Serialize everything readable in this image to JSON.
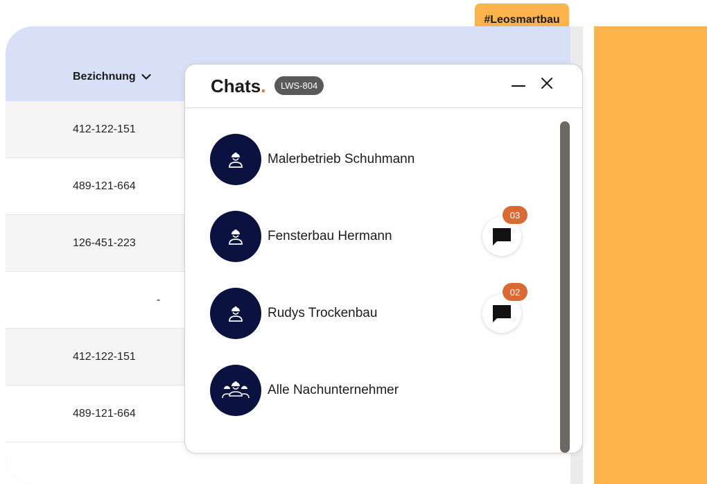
{
  "hashtag": "#Leosmartbau",
  "table": {
    "column_title": "Bezichnung",
    "rows": [
      {
        "value": "412-122-151"
      },
      {
        "value": "489-121-664"
      },
      {
        "value": "126-451-223"
      },
      {
        "value": "-"
      },
      {
        "value": "412-122-151"
      },
      {
        "value": "489-121-664"
      }
    ]
  },
  "chat": {
    "title": "Chats",
    "title_dot": ".",
    "project_badge": "LWS-804",
    "contacts": [
      {
        "name": "Malerbetrieb Schuhmann",
        "icon": "worker-icon",
        "unread": null
      },
      {
        "name": "Fensterbau Hermann",
        "icon": "worker-icon",
        "unread": "03"
      },
      {
        "name": "Rudys Trockenbau",
        "icon": "worker-icon",
        "unread": "02"
      },
      {
        "name": "Alle Nachunternehmer",
        "icon": "workers-group-icon",
        "unread": null
      }
    ]
  },
  "colors": {
    "accent_orange": "#fdb34c",
    "header_blue": "#d8e0f7",
    "avatar_navy": "#0c1240",
    "badge_orange": "#d96a34",
    "badge_gray": "#595959"
  }
}
